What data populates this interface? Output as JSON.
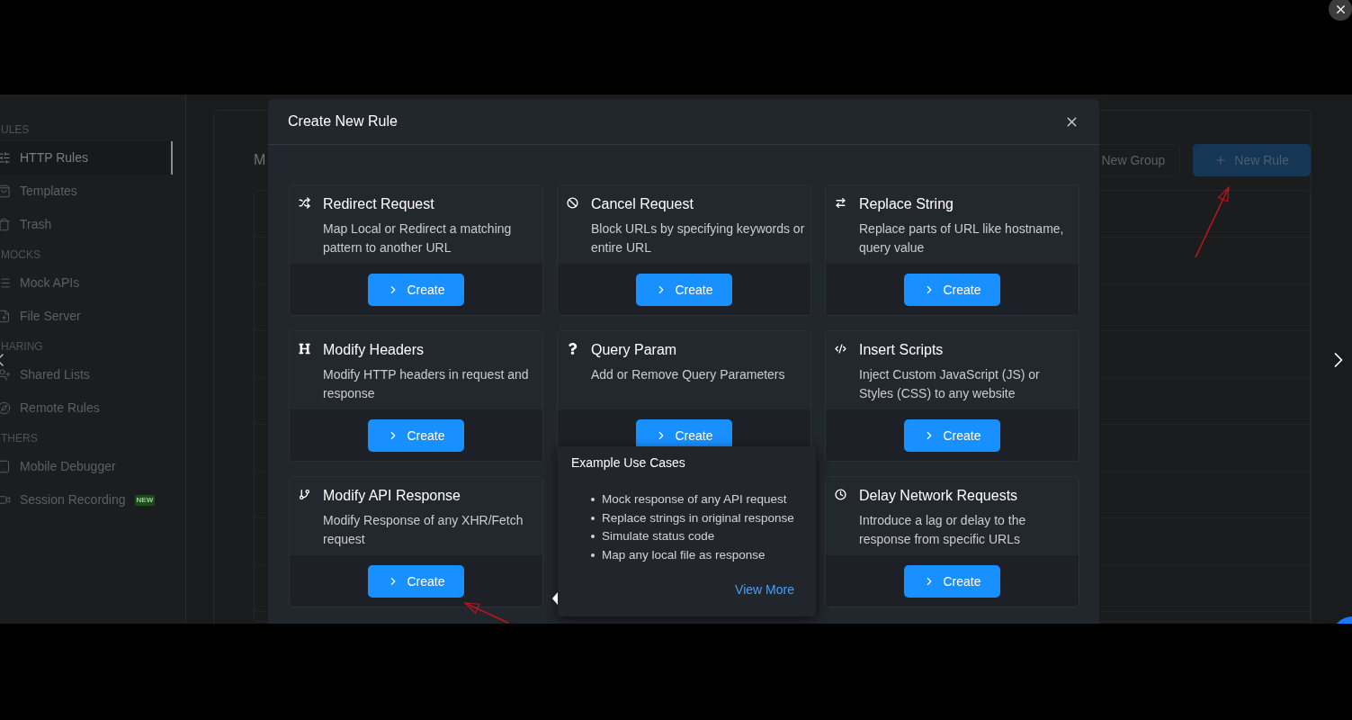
{
  "sidebar": {
    "sections": [
      {
        "heading": "ULES",
        "items": [
          {
            "label": "HTTP Rules",
            "selected": true
          },
          {
            "label": "Templates",
            "selected": false
          },
          {
            "label": "Trash",
            "selected": false
          }
        ]
      },
      {
        "heading": "MOCKS",
        "items": [
          {
            "label": "Mock APIs",
            "selected": false
          },
          {
            "label": "File Server",
            "selected": false
          }
        ]
      },
      {
        "heading": "HARING",
        "items": [
          {
            "label": "Shared Lists",
            "selected": false
          },
          {
            "label": "Remote Rules",
            "selected": false
          }
        ]
      },
      {
        "heading": "THERS",
        "items": [
          {
            "label": "Mobile Debugger",
            "selected": false
          },
          {
            "label": "Session Recording",
            "selected": false,
            "badge": "NEW"
          }
        ]
      }
    ]
  },
  "main": {
    "title": "M",
    "buttons": [
      {
        "label": "New Group",
        "kind": "default"
      },
      {
        "label": "New Rule",
        "kind": "primary"
      }
    ]
  },
  "modal": {
    "title": "Create New Rule",
    "rules": [
      {
        "title": "Redirect Request",
        "description": "Map Local or Redirect a matching pattern to another URL",
        "button": "Create"
      },
      {
        "title": "Cancel Request",
        "description": "Block URLs by specifying keywords or entire URL",
        "button": "Create"
      },
      {
        "title": "Replace String",
        "description": "Replace parts of URL like hostname, query value",
        "button": "Create"
      },
      {
        "title": "Modify Headers",
        "description": "Modify HTTP headers in request and response",
        "button": "Create"
      },
      {
        "title": "Query Param",
        "description": "Add or Remove Query Parameters",
        "button": "Create"
      },
      {
        "title": "Insert Scripts",
        "description": "Inject Custom JavaScript (JS) or Styles (CSS) to any website",
        "button": "Create"
      },
      {
        "title": "Modify API Response",
        "description": "Modify Response of any XHR/Fetch request",
        "button": "Create"
      },
      {
        "title": "Delay Network Requests",
        "description": "Introduce a lag or delay to the response from specific URLs",
        "button": "Create"
      }
    ],
    "popover": {
      "title": "Example Use Cases",
      "items": [
        "Mock response of any API request",
        "Replace strings in original response",
        "Simulate status code",
        "Map any local file as response"
      ],
      "link": "View More"
    }
  }
}
